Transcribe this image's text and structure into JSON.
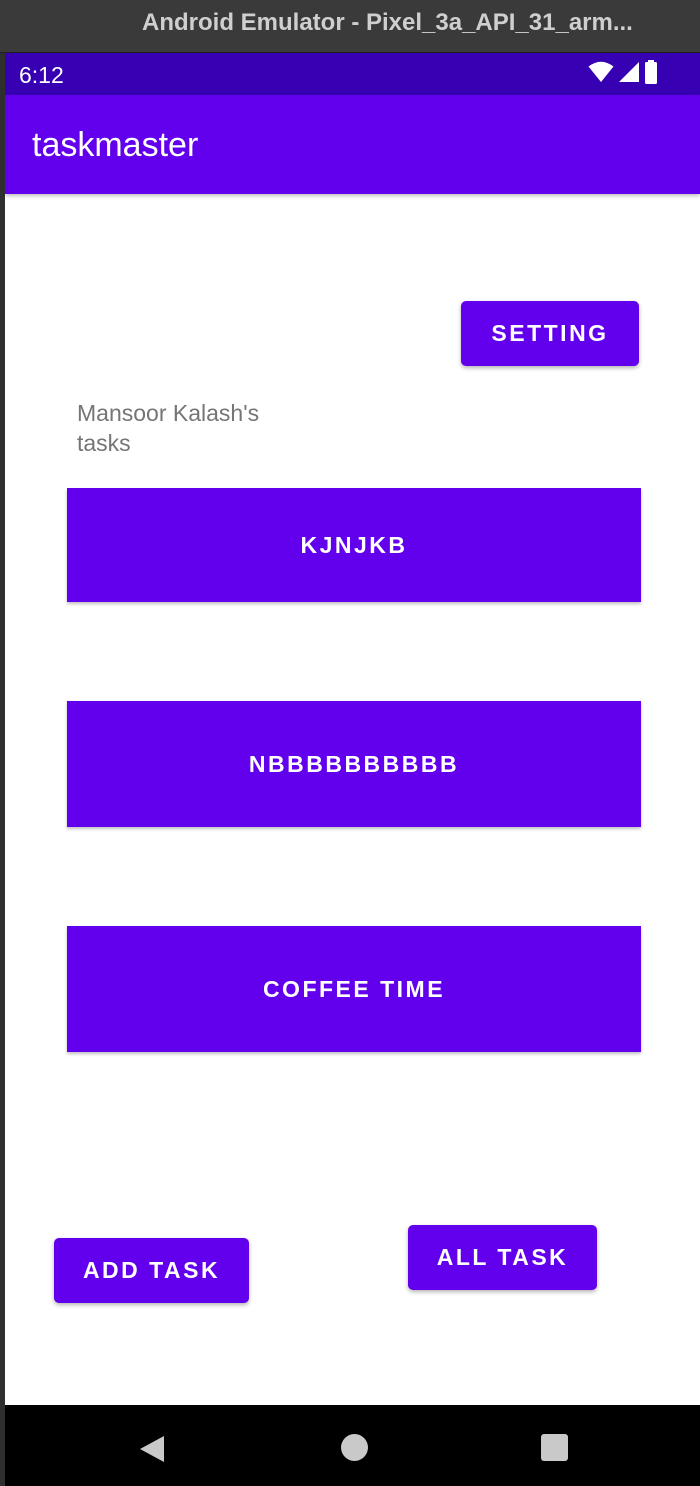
{
  "window": {
    "title": "Android Emulator - Pixel_3a_API_31_arm..."
  },
  "status_bar": {
    "time": "6:12",
    "icons": [
      "wifi-icon",
      "cellular-signal-icon",
      "battery-icon"
    ]
  },
  "app_bar": {
    "title": "taskmaster"
  },
  "main": {
    "setting_button": "SETTING",
    "user_tasks_heading": "Mansoor Kalash's tasks",
    "tasks": [
      {
        "label": "KJNJKB"
      },
      {
        "label": "NBBBBBBBBBB"
      },
      {
        "label": "COFFEE TIME"
      }
    ],
    "add_task_button": "ADD TASK",
    "all_task_button": "ALL TASK"
  },
  "nav_bar": {
    "icons": [
      "back-icon",
      "home-icon",
      "recents-icon"
    ]
  },
  "colors": {
    "primary": "#6200ee",
    "primary_dark": "#3700b3",
    "secondary_text": "#757575",
    "background": "#ffffff"
  }
}
